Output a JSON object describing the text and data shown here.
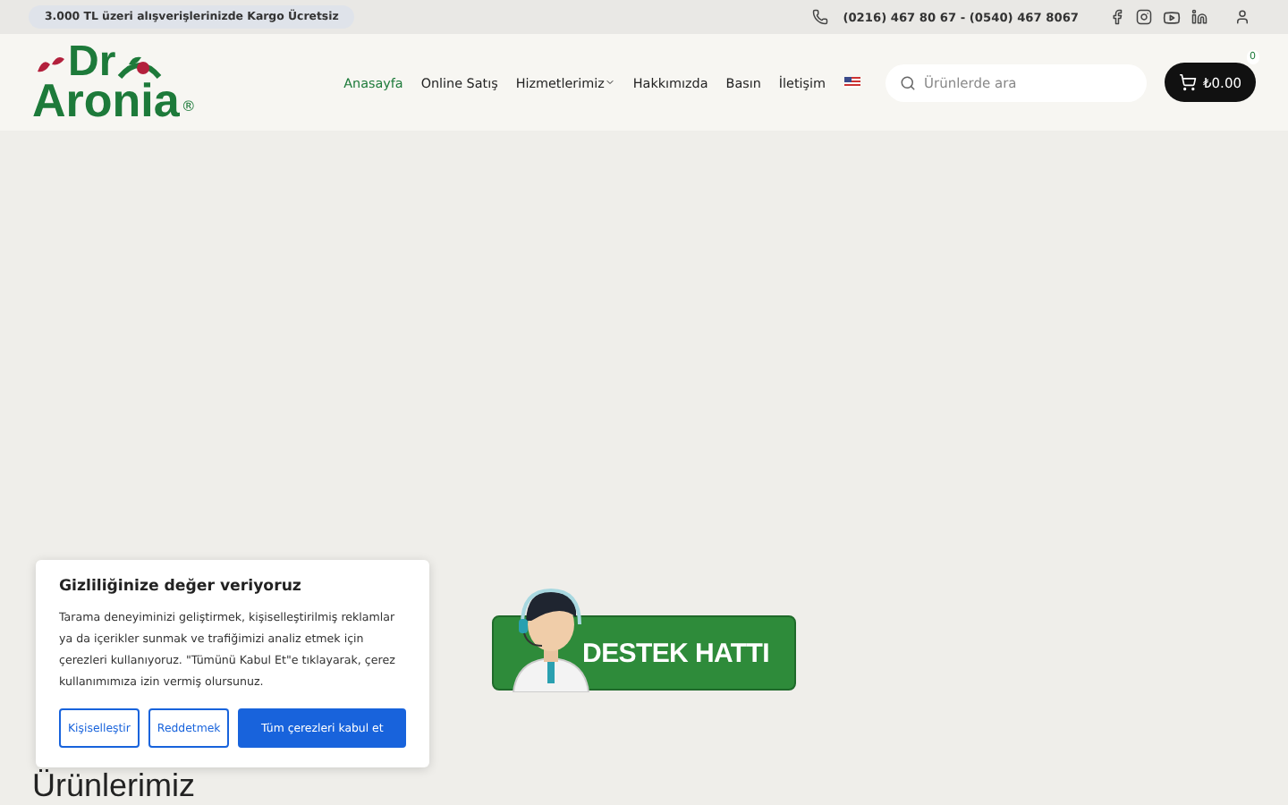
{
  "topbar": {
    "promo": "3.000 TL üzeri alışverişlerinizde Kargo Ücretsiz",
    "phone": "(0216) 467 80 67 - (0540) 467 8067"
  },
  "logo": {
    "line1": "Dr",
    "line2": "Aronia",
    "mark": "®"
  },
  "nav": [
    {
      "label": "Anasayfa",
      "selected": true,
      "dropdown": false
    },
    {
      "label": "Online Satış",
      "selected": false,
      "dropdown": false
    },
    {
      "label": "Hizmetlerimiz",
      "selected": false,
      "dropdown": true
    },
    {
      "label": "Hakkımızda",
      "selected": false,
      "dropdown": false
    },
    {
      "label": "Basın",
      "selected": false,
      "dropdown": false
    },
    {
      "label": "İletişim",
      "selected": false,
      "dropdown": false
    }
  ],
  "search": {
    "placeholder": "Ürünlerde ara"
  },
  "cart": {
    "total": "₺0.00",
    "count": "0"
  },
  "support": {
    "label": "DESTEK HATTI"
  },
  "section_title": "Ürünlerimiz",
  "cookie": {
    "title": "Gizliliğinize değer veriyoruz",
    "text": "Tarama deneyiminizi geliştirmek, kişiselleştirilmiş reklamlar ya da içerikler sunmak ve trafiğimizi analiz etmek için çerezleri kullanıyoruz. \"Tümünü Kabul Et\"e tıklayarak, çerez kullanımımıza izin vermiş olursunuz.",
    "buttons": [
      {
        "label": "Kişiselleştir",
        "kind": "outline"
      },
      {
        "label": "Reddetmek",
        "kind": "outline"
      },
      {
        "label": "Tüm çerezleri kabul et",
        "kind": "filled"
      }
    ]
  }
}
